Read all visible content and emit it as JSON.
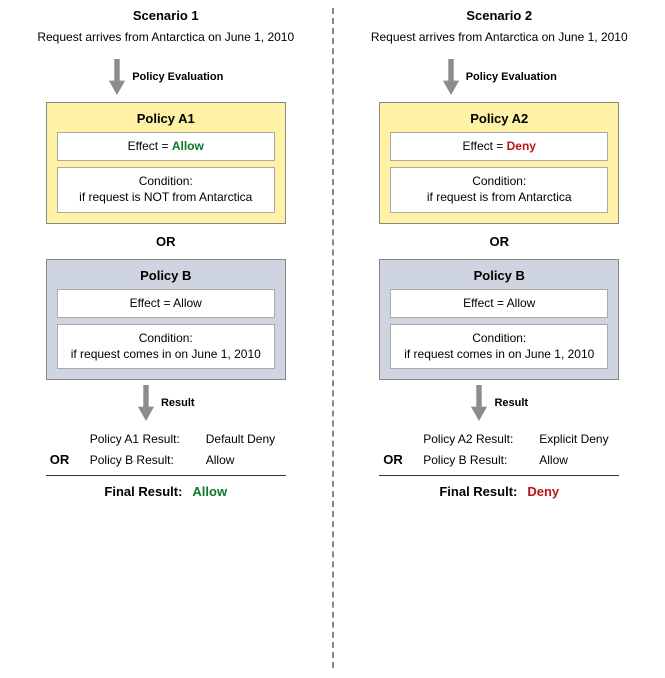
{
  "scenarios": [
    {
      "title": "Scenario 1",
      "request": "Request arrives from Antarctica on June 1, 2010",
      "arrow1_label": "Policy Evaluation",
      "policyA": {
        "title": "Policy A1",
        "effect_prefix": "Effect = ",
        "effect_value": "Allow",
        "effect_kind": "allow",
        "condition": "Condition:\nif request is NOT from Antarctica"
      },
      "or": "OR",
      "policyB": {
        "title": "Policy B",
        "effect": "Effect = Allow",
        "condition": "Condition:\nif request comes in on June 1, 2010"
      },
      "arrow2_label": "Result",
      "results": {
        "row1_label": "Policy A1 Result:",
        "row1_value": "Default Deny",
        "row2_or": "OR",
        "row2_label": "Policy B Result:",
        "row2_value": "Allow",
        "final_label": "Final Result:",
        "final_value": "Allow",
        "final_kind": "allow"
      }
    },
    {
      "title": "Scenario 2",
      "request": "Request arrives from Antarctica on June 1, 2010",
      "arrow1_label": "Policy Evaluation",
      "policyA": {
        "title": "Policy A2",
        "effect_prefix": "Effect = ",
        "effect_value": "Deny",
        "effect_kind": "deny",
        "condition": "Condition:\nif request is from Antarctica"
      },
      "or": "OR",
      "policyB": {
        "title": "Policy B",
        "effect": "Effect = Allow",
        "condition": "Condition:\nif request comes in on June 1, 2010"
      },
      "arrow2_label": "Result",
      "results": {
        "row1_label": "Policy A2 Result:",
        "row1_value": "Explicit Deny",
        "row2_or": "OR",
        "row2_label": "Policy B Result:",
        "row2_value": "Allow",
        "final_label": "Final Result:",
        "final_value": "Deny",
        "final_kind": "deny"
      }
    }
  ]
}
